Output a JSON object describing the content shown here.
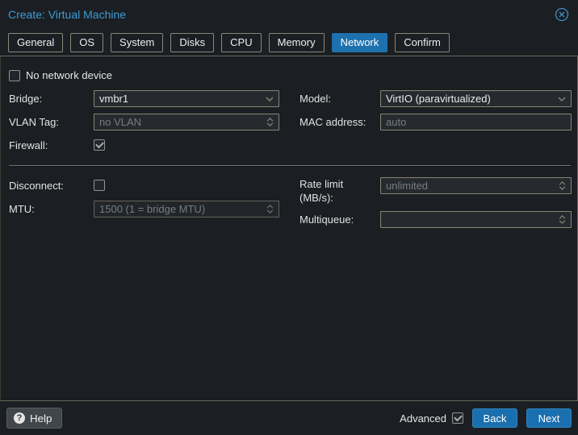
{
  "window": {
    "title": "Create: Virtual Machine",
    "close_icon": "circled-x"
  },
  "tabs": [
    {
      "label": "General",
      "active": false
    },
    {
      "label": "OS",
      "active": false
    },
    {
      "label": "System",
      "active": false
    },
    {
      "label": "Disks",
      "active": false
    },
    {
      "label": "CPU",
      "active": false
    },
    {
      "label": "Memory",
      "active": false
    },
    {
      "label": "Network",
      "active": true
    },
    {
      "label": "Confirm",
      "active": false
    }
  ],
  "form": {
    "no_network_device": {
      "label": "No network device",
      "checked": false
    },
    "bridge": {
      "label": "Bridge:",
      "value": "vmbr1",
      "type": "combobox"
    },
    "model": {
      "label": "Model:",
      "value": "VirtIO (paravirtualized)",
      "type": "combobox"
    },
    "vlan_tag": {
      "label": "VLAN Tag:",
      "placeholder": "no VLAN",
      "type": "number"
    },
    "mac_address": {
      "label": "MAC address:",
      "placeholder": "auto",
      "type": "text"
    },
    "firewall": {
      "label": "Firewall:",
      "checked": true
    },
    "disconnect": {
      "label": "Disconnect:",
      "checked": false
    },
    "mtu": {
      "label": "MTU:",
      "placeholder": "1500 (1 = bridge MTU)",
      "type": "number",
      "disabled": true
    },
    "rate_limit": {
      "label": "Rate limit (MB/s):",
      "placeholder": "unlimited",
      "type": "number"
    },
    "multiqueue": {
      "label": "Multiqueue:",
      "placeholder": "",
      "type": "number"
    }
  },
  "footer": {
    "help_label": "Help",
    "help_icon": "?",
    "advanced_label": "Advanced",
    "advanced_checked": true,
    "back_label": "Back",
    "next_label": "Next"
  },
  "colors": {
    "background": "#1b1e22",
    "title_blue": "#3d9bd5",
    "accent_blue": "#1d71ae",
    "field_border_tan": "#8a8474",
    "divider": "#69655b",
    "placeholder_gray": "#767c81"
  }
}
